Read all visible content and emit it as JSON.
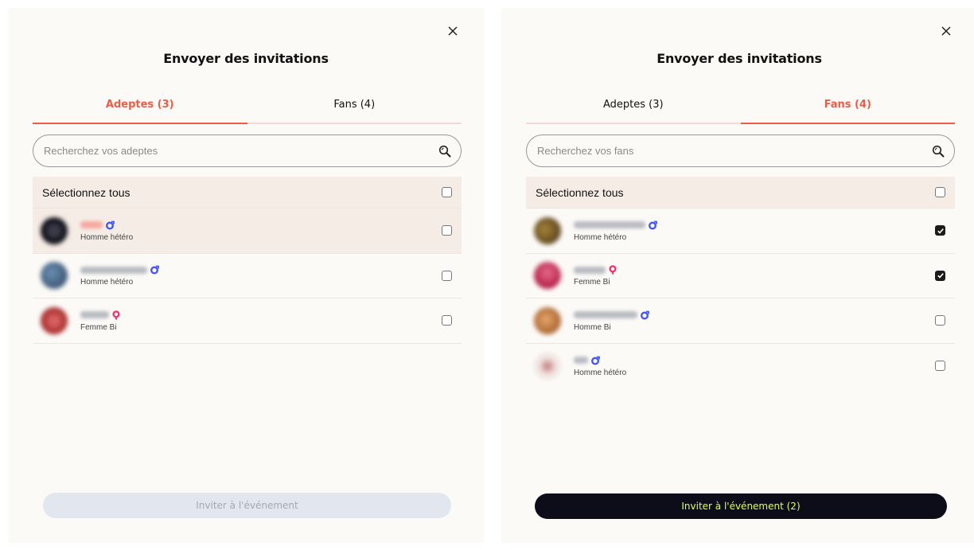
{
  "colors": {
    "accent": "#f15a45",
    "male": "#4257f5",
    "female": "#f0356e",
    "primary_bg": "#0d0d1a",
    "primary_text": "#e4ff3c"
  },
  "left": {
    "title": "Envoyer des invitations",
    "tabs": [
      {
        "label": "Adeptes (3)",
        "active": true
      },
      {
        "label": "Fans (4)",
        "active": false
      }
    ],
    "search": {
      "placeholder": "Recherchez vos adeptes",
      "value": ""
    },
    "select_all": {
      "label": "Sélectionnez tous",
      "checked": false
    },
    "users": [
      {
        "subtitle": "Homme hétéro",
        "gender": "male",
        "checked": false,
        "highlighted": true
      },
      {
        "subtitle": "Homme hétéro",
        "gender": "male",
        "checked": false,
        "highlighted": false
      },
      {
        "subtitle": "Femme Bi",
        "gender": "female",
        "checked": false,
        "highlighted": false
      }
    ],
    "button": {
      "label": "Inviter à l'événement",
      "enabled": false
    }
  },
  "right": {
    "title": "Envoyer des invitations",
    "tabs": [
      {
        "label": "Adeptes (3)",
        "active": false
      },
      {
        "label": "Fans (4)",
        "active": true
      }
    ],
    "search": {
      "placeholder": "Recherchez vos fans",
      "value": ""
    },
    "select_all": {
      "label": "Sélectionnez tous",
      "checked": false
    },
    "users": [
      {
        "subtitle": "Homme hétéro",
        "gender": "male",
        "checked": true,
        "highlighted": false
      },
      {
        "subtitle": "Femme Bi",
        "gender": "female",
        "checked": true,
        "highlighted": false
      },
      {
        "subtitle": "Homme Bi",
        "gender": "male",
        "checked": false,
        "highlighted": false
      },
      {
        "subtitle": "Homme hétéro",
        "gender": "male",
        "checked": false,
        "highlighted": false
      }
    ],
    "button": {
      "label": "Inviter à l'événement (2)",
      "enabled": true
    }
  }
}
